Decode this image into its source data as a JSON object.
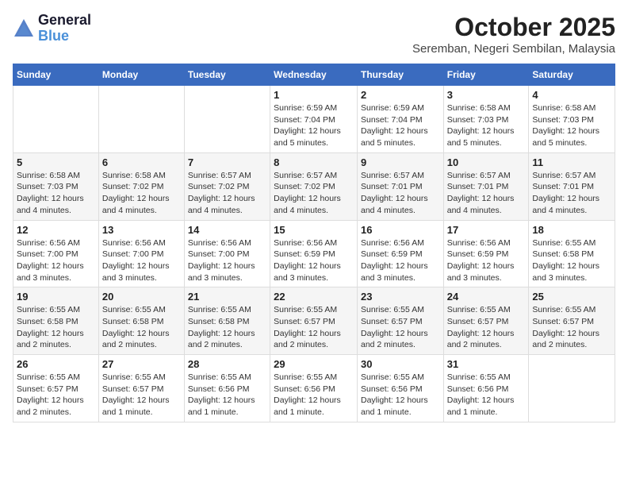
{
  "header": {
    "logo_line1": "General",
    "logo_line2": "Blue",
    "month": "October 2025",
    "location": "Seremban, Negeri Sembilan, Malaysia"
  },
  "weekdays": [
    "Sunday",
    "Monday",
    "Tuesday",
    "Wednesday",
    "Thursday",
    "Friday",
    "Saturday"
  ],
  "weeks": [
    [
      {
        "day": "",
        "info": ""
      },
      {
        "day": "",
        "info": ""
      },
      {
        "day": "",
        "info": ""
      },
      {
        "day": "1",
        "info": "Sunrise: 6:59 AM\nSunset: 7:04 PM\nDaylight: 12 hours\nand 5 minutes."
      },
      {
        "day": "2",
        "info": "Sunrise: 6:59 AM\nSunset: 7:04 PM\nDaylight: 12 hours\nand 5 minutes."
      },
      {
        "day": "3",
        "info": "Sunrise: 6:58 AM\nSunset: 7:03 PM\nDaylight: 12 hours\nand 5 minutes."
      },
      {
        "day": "4",
        "info": "Sunrise: 6:58 AM\nSunset: 7:03 PM\nDaylight: 12 hours\nand 5 minutes."
      }
    ],
    [
      {
        "day": "5",
        "info": "Sunrise: 6:58 AM\nSunset: 7:03 PM\nDaylight: 12 hours\nand 4 minutes."
      },
      {
        "day": "6",
        "info": "Sunrise: 6:58 AM\nSunset: 7:02 PM\nDaylight: 12 hours\nand 4 minutes."
      },
      {
        "day": "7",
        "info": "Sunrise: 6:57 AM\nSunset: 7:02 PM\nDaylight: 12 hours\nand 4 minutes."
      },
      {
        "day": "8",
        "info": "Sunrise: 6:57 AM\nSunset: 7:02 PM\nDaylight: 12 hours\nand 4 minutes."
      },
      {
        "day": "9",
        "info": "Sunrise: 6:57 AM\nSunset: 7:01 PM\nDaylight: 12 hours\nand 4 minutes."
      },
      {
        "day": "10",
        "info": "Sunrise: 6:57 AM\nSunset: 7:01 PM\nDaylight: 12 hours\nand 4 minutes."
      },
      {
        "day": "11",
        "info": "Sunrise: 6:57 AM\nSunset: 7:01 PM\nDaylight: 12 hours\nand 4 minutes."
      }
    ],
    [
      {
        "day": "12",
        "info": "Sunrise: 6:56 AM\nSunset: 7:00 PM\nDaylight: 12 hours\nand 3 minutes."
      },
      {
        "day": "13",
        "info": "Sunrise: 6:56 AM\nSunset: 7:00 PM\nDaylight: 12 hours\nand 3 minutes."
      },
      {
        "day": "14",
        "info": "Sunrise: 6:56 AM\nSunset: 7:00 PM\nDaylight: 12 hours\nand 3 minutes."
      },
      {
        "day": "15",
        "info": "Sunrise: 6:56 AM\nSunset: 6:59 PM\nDaylight: 12 hours\nand 3 minutes."
      },
      {
        "day": "16",
        "info": "Sunrise: 6:56 AM\nSunset: 6:59 PM\nDaylight: 12 hours\nand 3 minutes."
      },
      {
        "day": "17",
        "info": "Sunrise: 6:56 AM\nSunset: 6:59 PM\nDaylight: 12 hours\nand 3 minutes."
      },
      {
        "day": "18",
        "info": "Sunrise: 6:55 AM\nSunset: 6:58 PM\nDaylight: 12 hours\nand 3 minutes."
      }
    ],
    [
      {
        "day": "19",
        "info": "Sunrise: 6:55 AM\nSunset: 6:58 PM\nDaylight: 12 hours\nand 2 minutes."
      },
      {
        "day": "20",
        "info": "Sunrise: 6:55 AM\nSunset: 6:58 PM\nDaylight: 12 hours\nand 2 minutes."
      },
      {
        "day": "21",
        "info": "Sunrise: 6:55 AM\nSunset: 6:58 PM\nDaylight: 12 hours\nand 2 minutes."
      },
      {
        "day": "22",
        "info": "Sunrise: 6:55 AM\nSunset: 6:57 PM\nDaylight: 12 hours\nand 2 minutes."
      },
      {
        "day": "23",
        "info": "Sunrise: 6:55 AM\nSunset: 6:57 PM\nDaylight: 12 hours\nand 2 minutes."
      },
      {
        "day": "24",
        "info": "Sunrise: 6:55 AM\nSunset: 6:57 PM\nDaylight: 12 hours\nand 2 minutes."
      },
      {
        "day": "25",
        "info": "Sunrise: 6:55 AM\nSunset: 6:57 PM\nDaylight: 12 hours\nand 2 minutes."
      }
    ],
    [
      {
        "day": "26",
        "info": "Sunrise: 6:55 AM\nSunset: 6:57 PM\nDaylight: 12 hours\nand 2 minutes."
      },
      {
        "day": "27",
        "info": "Sunrise: 6:55 AM\nSunset: 6:57 PM\nDaylight: 12 hours\nand 1 minute."
      },
      {
        "day": "28",
        "info": "Sunrise: 6:55 AM\nSunset: 6:56 PM\nDaylight: 12 hours\nand 1 minute."
      },
      {
        "day": "29",
        "info": "Sunrise: 6:55 AM\nSunset: 6:56 PM\nDaylight: 12 hours\nand 1 minute."
      },
      {
        "day": "30",
        "info": "Sunrise: 6:55 AM\nSunset: 6:56 PM\nDaylight: 12 hours\nand 1 minute."
      },
      {
        "day": "31",
        "info": "Sunrise: 6:55 AM\nSunset: 6:56 PM\nDaylight: 12 hours\nand 1 minute."
      },
      {
        "day": "",
        "info": ""
      }
    ]
  ]
}
